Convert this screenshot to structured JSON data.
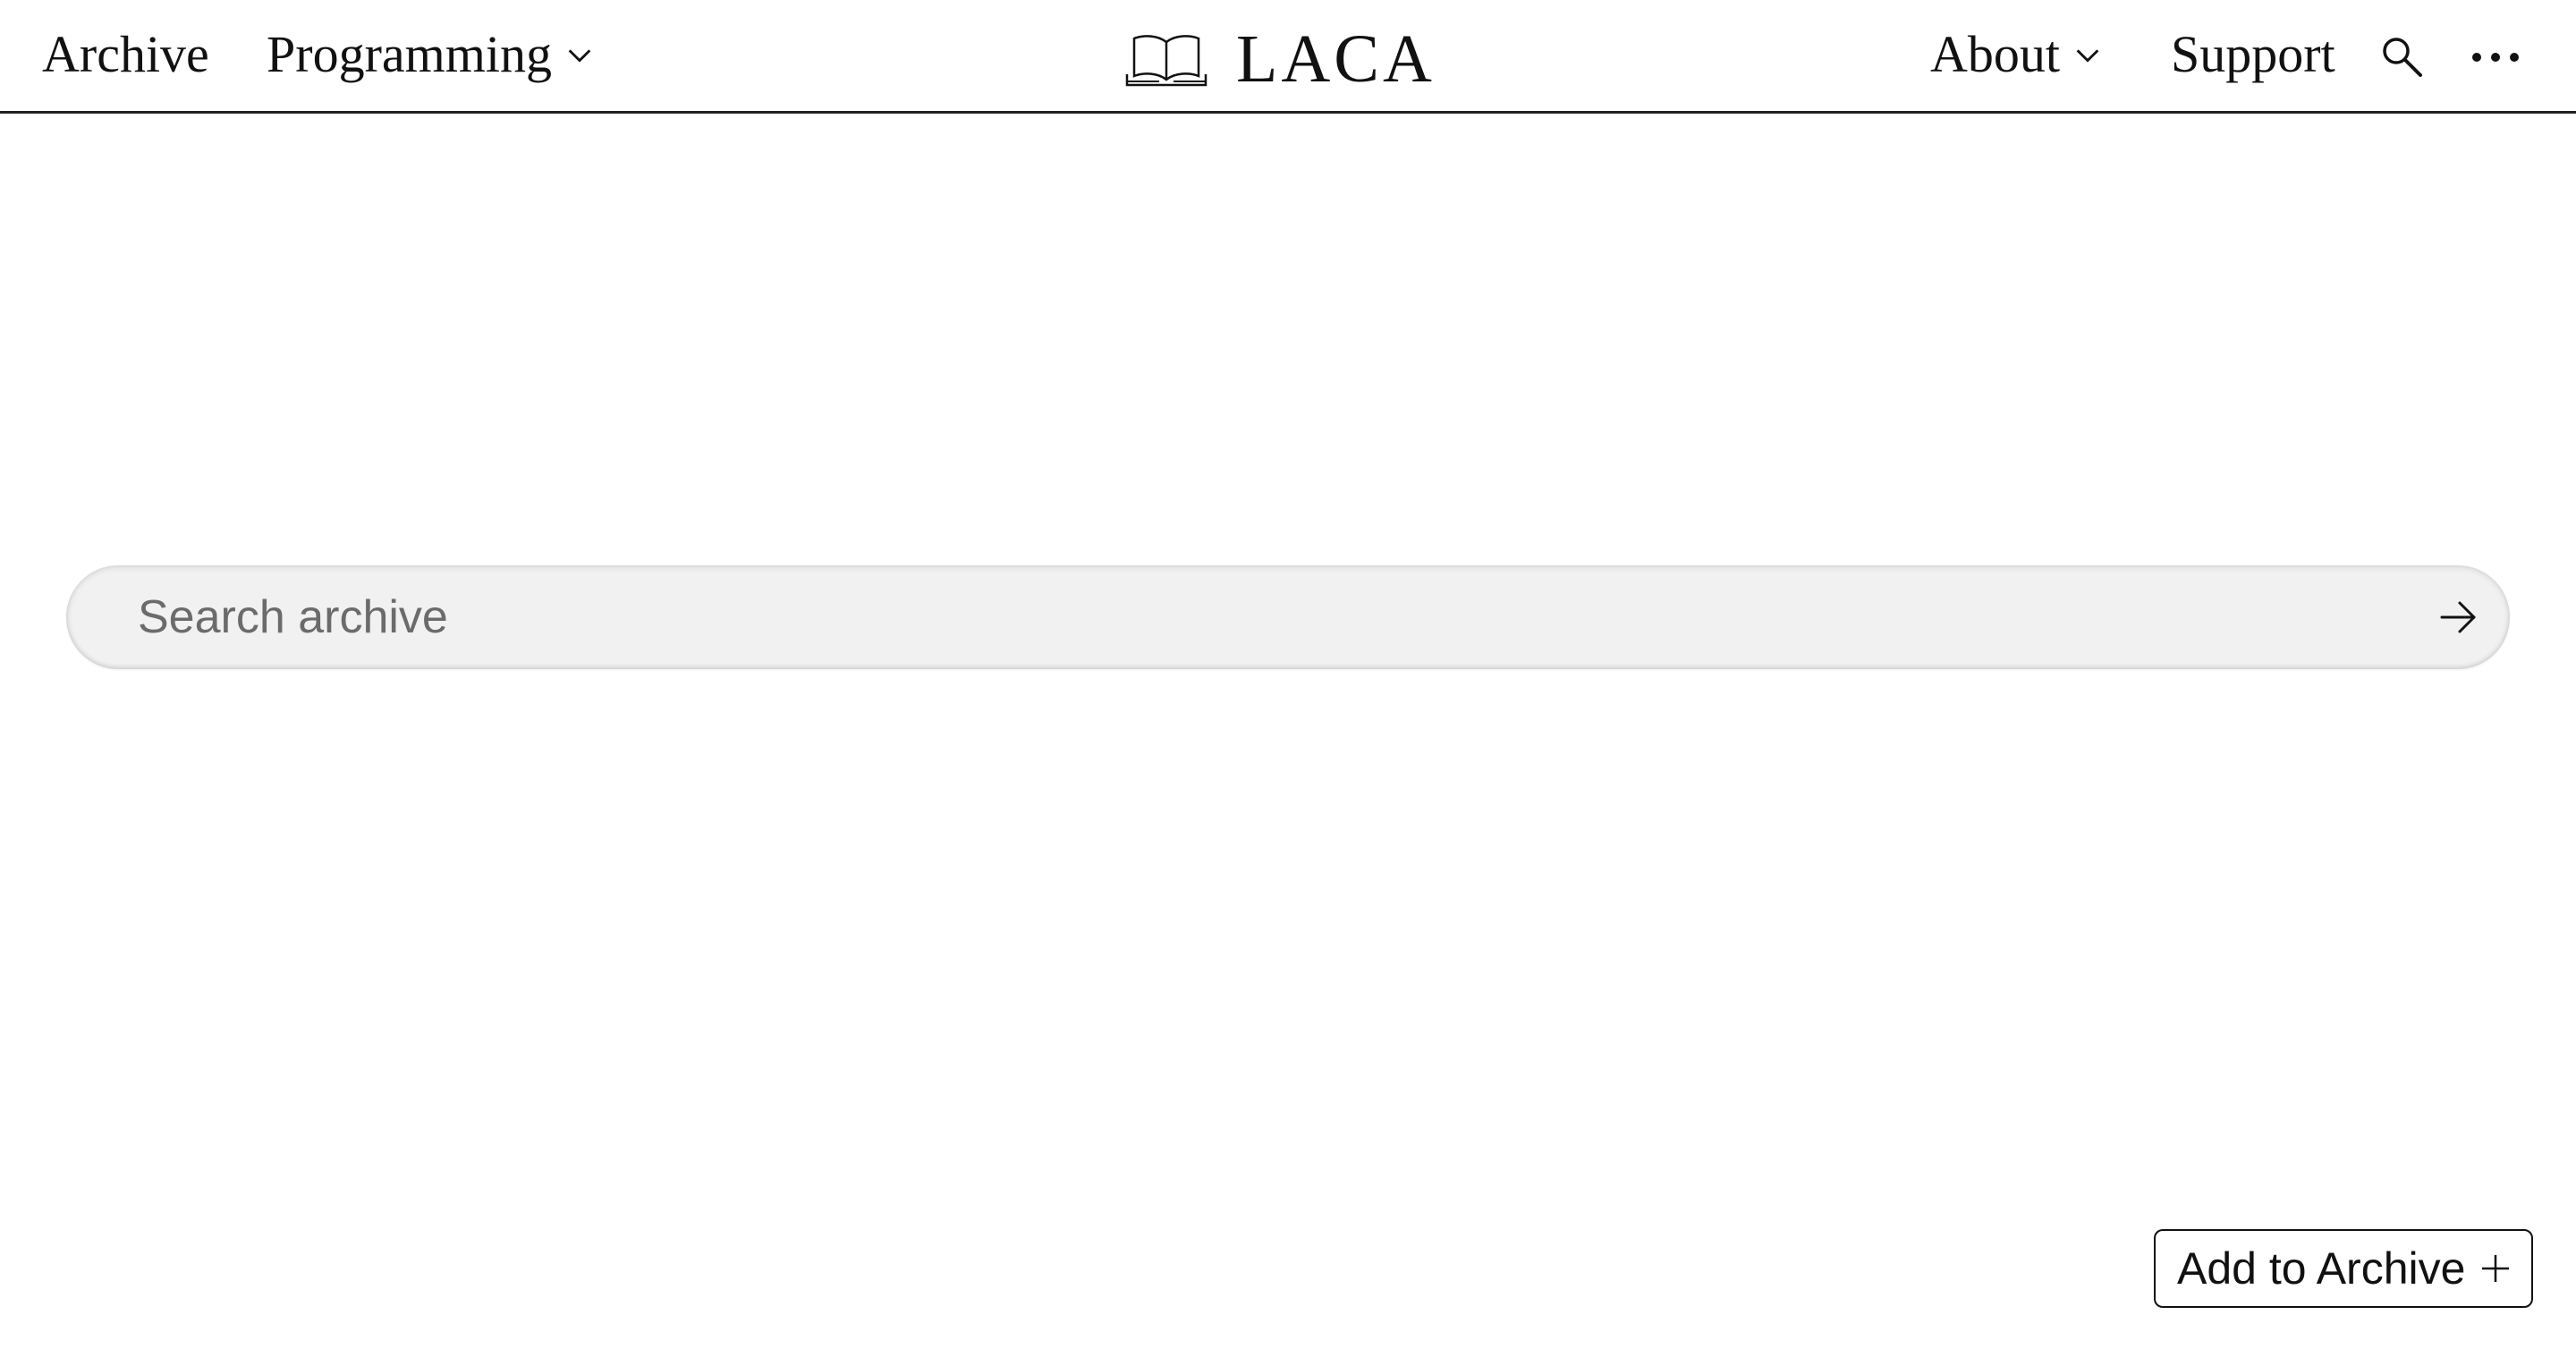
{
  "nav": {
    "left": [
      {
        "label": "Archive",
        "has_dropdown": false
      },
      {
        "label": "Programming",
        "has_dropdown": true
      }
    ],
    "right": [
      {
        "label": "About",
        "has_dropdown": true
      },
      {
        "label": "Support",
        "has_dropdown": false
      }
    ],
    "icons": [
      "search-icon",
      "more-icon"
    ]
  },
  "logo": {
    "text": "LACA",
    "icon": "open-book-icon"
  },
  "search": {
    "placeholder": "Search archive",
    "value": "",
    "submit_icon": "arrow-right-icon"
  },
  "actions": {
    "add_label": "Add to Archive",
    "add_icon": "plus-icon"
  },
  "colors": {
    "text": "#111111",
    "search_bg": "#f1f1f1",
    "placeholder": "#6b6b6b",
    "border": "#222222"
  }
}
